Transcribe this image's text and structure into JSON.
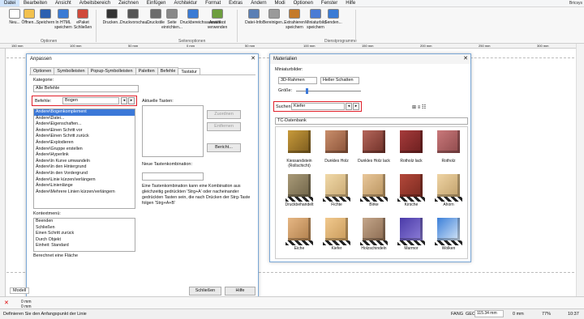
{
  "menubar": {
    "items": [
      "Datei",
      "Bearbeiten",
      "Ansicht",
      "Arbeitsbereich",
      "Zeichnen",
      "Einfügen",
      "Architektur",
      "Format",
      "Extras",
      "Ändern",
      "Modi",
      "Optionen",
      "Fenster",
      "Hilfe"
    ],
    "brand": "Bricsys"
  },
  "ribbon": {
    "buttons": [
      "Neu...",
      "Öffnen...",
      "Speichern",
      "In HTML speichern",
      "ePaket Schließen",
      "Drucken...",
      "Druckvorschau...",
      "Druckstile",
      "Seite einrichten...",
      "Druckbereichsauswahl...",
      "Assistent verwenden",
      "Datei-Info",
      "Bereinigen...",
      "Extrahieren speichern",
      "Miniaturbild speichern",
      "Senden..."
    ],
    "groups": [
      "Optionen",
      "Seitenoptionen",
      "Dienstprogramme"
    ]
  },
  "ruler": {
    "top_marks": [
      "150 mm",
      "100 mm",
      "50 mm",
      "0 mm",
      "50 mm",
      "100 mm",
      "150 mm",
      "200 mm",
      "250 mm",
      "300 mm"
    ]
  },
  "dialog": {
    "title": "Anpassen",
    "close": "✕",
    "tabs": [
      "Optionen",
      "Symbolleisten",
      "Popup-Symbolleisten",
      "Paletten",
      "Befehle",
      "Tastatur"
    ],
    "category_label": "Kategorie:",
    "category_value": "Alle Befehle",
    "commands_label": "Befehle:",
    "commands_search": "Bogen",
    "current_keys_label": "Aktuelle Tasten:",
    "commands": [
      "Ändere\\Bogenkomplement",
      "Ändere\\Datei...",
      "Ändere\\Eigenschaften...",
      "Ändere\\Einen Schritt vor",
      "Ändere\\Einen Schritt zurück",
      "Ändere\\Explodieren",
      "Ändere\\Gruppe erstellen",
      "Ändere\\Hyperlink",
      "Ändere\\In Kurve umwandeln",
      "Ändere\\In den Hintergrund",
      "Ändere\\In den Vordergrund",
      "Ändere\\Linie kürzen/verlängern",
      "Ändere\\Linienlänge",
      "Ändere\\Mehrere Linien kürzen/verlängern"
    ],
    "context_label": "Kontextmenü:",
    "context_items": [
      "Beenden",
      "Schließen",
      "Einen Schritt zurück",
      "Durch Objekt",
      "Einheit: Standard"
    ],
    "description": "Berechnet eine Fläche",
    "assign_button": "Zuordnen",
    "remove_button": "Entfernen",
    "report_button": "Bericht...",
    "new_combo_label": "Neue Tastenkombination:",
    "help_text": "Eine Tastenkombination kann eine Kombination aus gleichzeitig gedrückten 'Strg+A' oder nacheinander gedrückten Tasten sein, die nach Drücken der Strg-Taste folgen 'Strg+A+B'",
    "close_button": "Schließen",
    "help_button": "Hilfe"
  },
  "materials": {
    "title": "Materialien",
    "thumbs_label": "Miniaturbilder:",
    "render_mode": "3D-Rahmen",
    "shadow_mode": "Heller Schatten",
    "size_label": "Größe:",
    "search_label": "Suchen",
    "search_value": "Kiefer",
    "database": "TC-Datenbank",
    "tiles": [
      {
        "name": "Kiessandstein (Rollschicht)",
        "color": "#c89a3a",
        "color2": "#7a5a1e"
      },
      {
        "name": "Dunkles Holz",
        "color": "#c98e6b",
        "color2": "#8a5238"
      },
      {
        "name": "Dunkles Holz lack",
        "color": "#b5665a",
        "color2": "#6e3028"
      },
      {
        "name": "Rotholz lack",
        "color": "#a63b3b",
        "color2": "#6b1f1f"
      },
      {
        "name": "Rotholz",
        "color": "#c9787a",
        "color2": "#8e4a4c"
      },
      {
        "name": "Druckbehandelt",
        "color": "#a99a78",
        "color2": "#6f6448"
      },
      {
        "name": "Fichte",
        "color": "#f1d9a8",
        "color2": "#c9a973"
      },
      {
        "name": "Birke",
        "color": "#e9c79a",
        "color2": "#b8935e"
      },
      {
        "name": "Kirsche",
        "color": "#b3483a",
        "color2": "#7a2a20"
      },
      {
        "name": "Ahorn",
        "color": "#efd4a4",
        "color2": "#c0a06a"
      },
      {
        "name": "Eiche",
        "color": "#e6b784",
        "color2": "#b07f4c"
      },
      {
        "name": "Kiefer",
        "color": "#f1c98e",
        "color2": "#c89a5a"
      },
      {
        "name": "Holzschindeln",
        "color": "#c4a68a",
        "color2": "#8a6a50"
      },
      {
        "name": "Marmor",
        "color": "#4a3aa8",
        "color2": "#8e7fd8"
      },
      {
        "name": "Wolken",
        "color": "#3b7fd8",
        "color2": "#d8e8f8"
      }
    ]
  },
  "cmdline": {
    "tab_label": "Modell",
    "prompt": "Definieren Sie den Anfangspunkt der Linie",
    "x_value": "0 mm",
    "y_value": "0 mm"
  },
  "statusbar": {
    "items": [
      "FANG",
      "GEO"
    ],
    "coords": "115.34 mm",
    "zoom_coords": "0 mm",
    "percent": "77%",
    "time": "10:37"
  },
  "accent": "#e0202a"
}
